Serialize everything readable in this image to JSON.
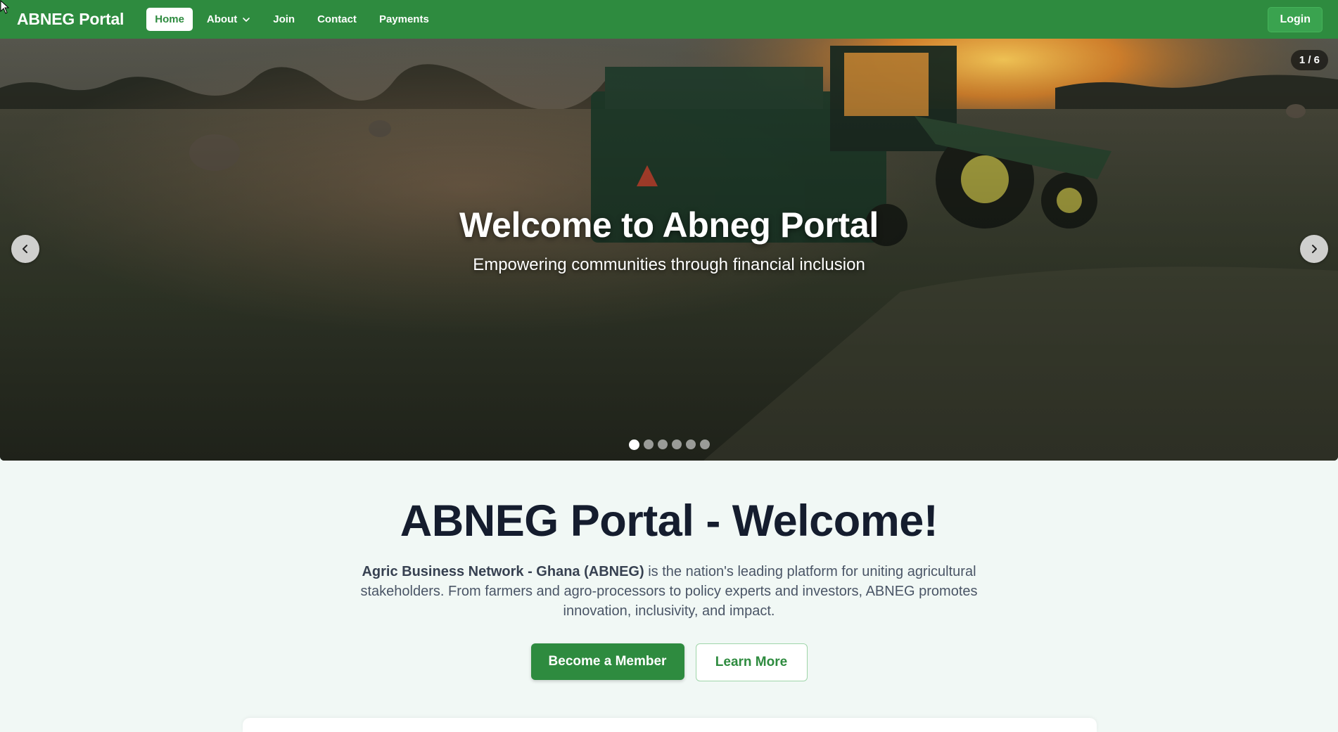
{
  "navbar": {
    "brand": "ABNEG Portal",
    "links": [
      {
        "label": "Home",
        "active": true
      },
      {
        "label": "About",
        "has_dropdown": true
      },
      {
        "label": "Join"
      },
      {
        "label": "Contact"
      },
      {
        "label": "Payments"
      }
    ],
    "login_label": "Login"
  },
  "hero": {
    "title": "Welcome to Abneg Portal",
    "subtitle": "Empowering communities through financial inclusion",
    "slide_counter": "1 / 6",
    "slide_count": 6,
    "active_slide": 1
  },
  "welcome": {
    "title": "ABNEG Portal - Welcome!",
    "description_bold": "Agric Business Network - Ghana (ABNEG)",
    "description_rest": " is the nation's leading platform for uniting agricultural stakeholders. From farmers and agro-processors to policy experts and investors, ABNEG promotes innovation, inclusivity, and impact.",
    "primary_cta": "Become a Member",
    "secondary_cta": "Learn More"
  },
  "colors": {
    "brand_green": "#2e8b3f",
    "title_dark": "#151d2e",
    "page_bg": "#f1f8f5"
  }
}
